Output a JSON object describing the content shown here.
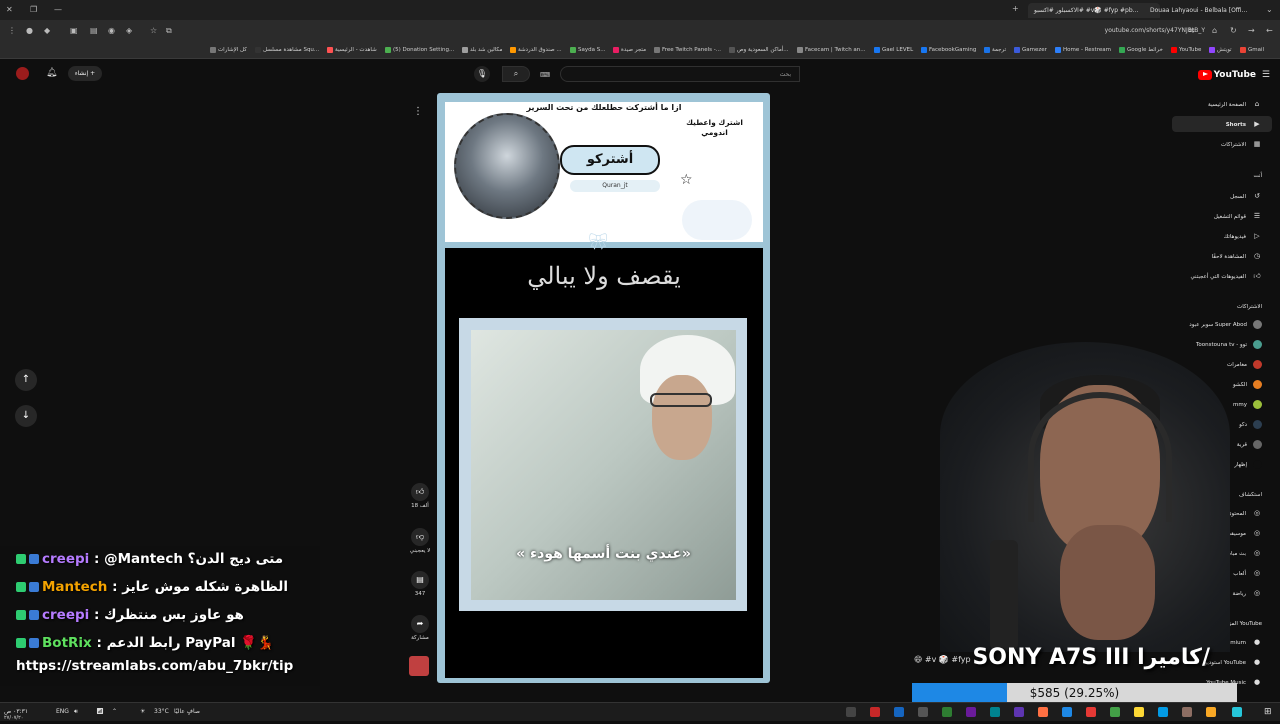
{
  "browser": {
    "tabs": [
      {
        "label": "الاكسبلور #اكسبو# #v🎲 #fyp #pb...",
        "active": true
      },
      {
        "label": "Douaa Lahyaoui - Belbala [Offi...",
        "active": false
      }
    ],
    "url": "youtube.com/shorts/y47YNJBtB_Y",
    "bookmarks": [
      {
        "label": "Gmail",
        "color": "#ea4335"
      },
      {
        "label": "تويتش",
        "color": "#9146ff"
      },
      {
        "label": "YouTube",
        "color": "#ff0000"
      },
      {
        "label": "Google خرائط",
        "color": "#34a853"
      },
      {
        "label": "Home - Restream",
        "color": "#2d7ff9"
      },
      {
        "label": "Gamezer",
        "color": "#3b5bdb"
      },
      {
        "label": "ترجمة",
        "color": "#1a73e8"
      },
      {
        "label": "FacebookGaming",
        "color": "#1877f2"
      },
      {
        "label": "Gael LEVEL",
        "color": "#1877f2"
      },
      {
        "label": "Facecam | Twitch an...",
        "color": "#888888"
      },
      {
        "label": "أماكن السعودية وص...",
        "color": "#555555"
      },
      {
        "label": "Free Twitch Panels -...",
        "color": "#777777"
      },
      {
        "label": "متجر صيدة",
        "color": "#e91e63"
      },
      {
        "label": "Sayda S...",
        "color": "#4caf50"
      },
      {
        "label": "صندوق الدردشة ...",
        "color": "#ff9800"
      },
      {
        "label": "مكالين شد بلد",
        "color": "#9e9e9e"
      },
      {
        "label": "(5) Donation Setting...",
        "color": "#4caf50"
      },
      {
        "label": "شاهدت - الرئيسية",
        "color": "#ff5252"
      },
      {
        "label": "مشاهدة مسلسل Squ...",
        "color": "#333333"
      },
      {
        "label": "كل الإشارات",
        "color": "#777777"
      }
    ]
  },
  "youtube": {
    "logo_text": "YouTube",
    "search_placeholder": "بحث",
    "create_label": "إنشاء",
    "sidebar": {
      "items": [
        {
          "label": "الصفحة الرئيسية",
          "icon": "home-icon"
        },
        {
          "label": "Shorts",
          "icon": "shorts-icon",
          "active": true
        },
        {
          "label": "الاشتراكات",
          "icon": "subscriptions-icon"
        }
      ],
      "you_label": "أنت",
      "you_items": [
        {
          "label": "السجل",
          "icon": "history-icon"
        },
        {
          "label": "قوائم التشغيل",
          "icon": "playlist-icon"
        },
        {
          "label": "فيديوهاتك",
          "icon": "your-videos-icon"
        },
        {
          "label": "المشاهدة لاحقًا",
          "icon": "watch-later-icon"
        },
        {
          "label": "الفيديوهات التي أعجبتني",
          "icon": "liked-icon"
        }
      ],
      "subscriptions_label": "الاشتراكات",
      "subscriptions": [
        {
          "label": "سوبر عبود Super Abod",
          "color": "#777777"
        },
        {
          "label": "Toonstouna tv - توو",
          "color": "#4a9d8f"
        },
        {
          "label": "مغامرات",
          "color": "#c0392b"
        },
        {
          "label": "الكشو",
          "color": "#e67e22"
        },
        {
          "label": "mmy",
          "color": "#9bbf3b"
        },
        {
          "label": "دكو",
          "color": "#2c3e50"
        },
        {
          "label": "قرية",
          "color": "#666666"
        },
        {
          "label": "إظهار",
          "color": "#0f0f0f"
        }
      ],
      "explore_label": "استكشاف",
      "explore_items": [
        "المحتوى",
        "موسيقى",
        "بث مباشر",
        "ألعاب",
        "رياضة"
      ],
      "more_label": "المزيد من YouTube",
      "more_items": [
        "YouTube Premium",
        "استوديو YouTube",
        "YouTube Music"
      ]
    }
  },
  "short": {
    "banner_title": "ازا ما أشتركت حطلعلك من تحت السرير",
    "subscribe_badge": "أشتركو",
    "handle": "Quran_jt",
    "side_banner": "اشترك واعطيك اندومي",
    "caption": "يقصف ولا يبالي",
    "video_subtitle": "« عندي بنت أسمها هودء»",
    "actions": {
      "like_count": "18 ألف",
      "dislike_label": "لا يعجبني",
      "comments_count": "347",
      "share_label": "مشاركة"
    }
  },
  "chat": {
    "messages": [
      {
        "user": "creepi",
        "user_color": "#b57bff",
        "text": ": @Mantech متى ديج الدن؟"
      },
      {
        "user": "Mantech",
        "user_color": "#f4a300",
        "text": ": الظاهرة شكله موش عايز"
      },
      {
        "user": "creepi",
        "user_color": "#b57bff",
        "text": ": هو عاوز بس منتظرك"
      },
      {
        "user": "BotRix",
        "user_color": "#5ee05e",
        "text": ": رابط الدعم PayPal 🌹💃"
      }
    ],
    "link": "https://streamlabs.com/abu_7bkr/tip"
  },
  "overlay": {
    "camera_label": "SONY A7S III كاميرا/",
    "ticker": "😄 #v 🎲 #fyp",
    "donation_text": "$585 (29.25%)",
    "donation_progress": 0.2925,
    "accent": "#1e88e5"
  },
  "taskbar": {
    "weather": "33°C",
    "weather_desc": "صافٍ عاليًا",
    "lang": "ENG",
    "time": "٠٣:٣١ ص",
    "date": "٢٧/٠٧/٢٠"
  }
}
